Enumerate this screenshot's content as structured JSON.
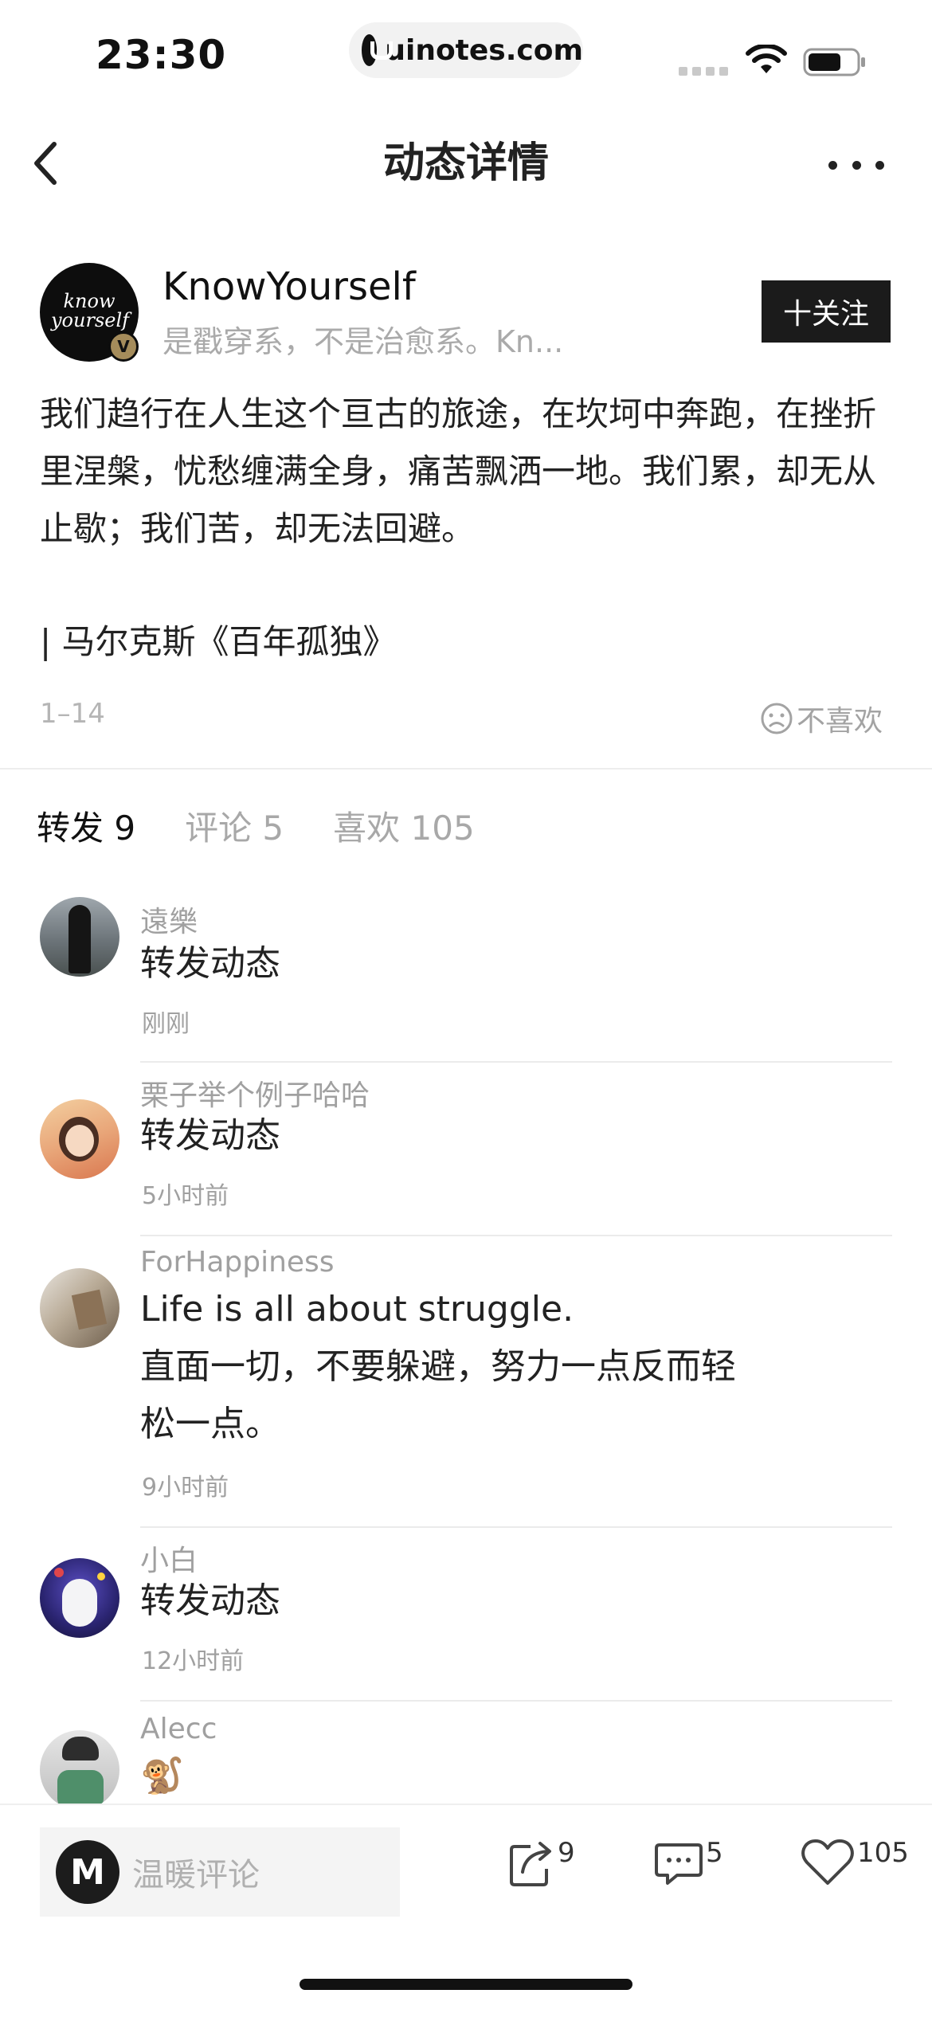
{
  "status_bar": {
    "time": "23:30",
    "url": "uinotes.com"
  },
  "nav": {
    "title": "动态详情"
  },
  "author": {
    "avatar_text": "know yourself",
    "badge": "V",
    "name": "KnowYourself",
    "bio": "是戳穿系，不是治愈系。Kn...",
    "follow_label": "十关注"
  },
  "post": {
    "body": "我们趋行在人生这个亘古的旅途，在坎坷中奔跑，在挫折里涅槃，忧愁缠满全身，痛苦飘洒一地。我们累，却无从止歇；我们苦，却无法回避。",
    "quote": "| 马尔克斯《百年孤独》",
    "date": "1–14",
    "dislike_label": "不喜欢"
  },
  "tabs": [
    {
      "label": "转发 9",
      "active": true
    },
    {
      "label": "评论 5",
      "active": false
    },
    {
      "label": "喜欢 105",
      "active": false
    }
  ],
  "reposts": [
    {
      "name": "遠樂",
      "text": "转发动态",
      "time": "刚刚"
    },
    {
      "name": "栗子举个例子哈哈",
      "text": "转发动态",
      "time": "5小时前"
    },
    {
      "name": "ForHappiness",
      "text": "Life is all about struggle.",
      "text2": "直面一切，不要躲避，努力一点反而轻",
      "text3": "松一点。",
      "time": "9小时前"
    },
    {
      "name": "小白",
      "text": "转发动态",
      "time": "12小时前"
    },
    {
      "name": "Alecc",
      "text": "🐒"
    }
  ],
  "bottom_bar": {
    "me_avatar": "M",
    "placeholder": "温暖评论",
    "repost_count": "9",
    "comment_count": "5",
    "like_count": "105"
  },
  "icons": {
    "back": "chevron-left-icon",
    "more": "more-horizontal-icon",
    "dislike": "sad-face-icon",
    "repost": "share-icon",
    "comment": "comment-icon",
    "like": "heart-icon"
  }
}
